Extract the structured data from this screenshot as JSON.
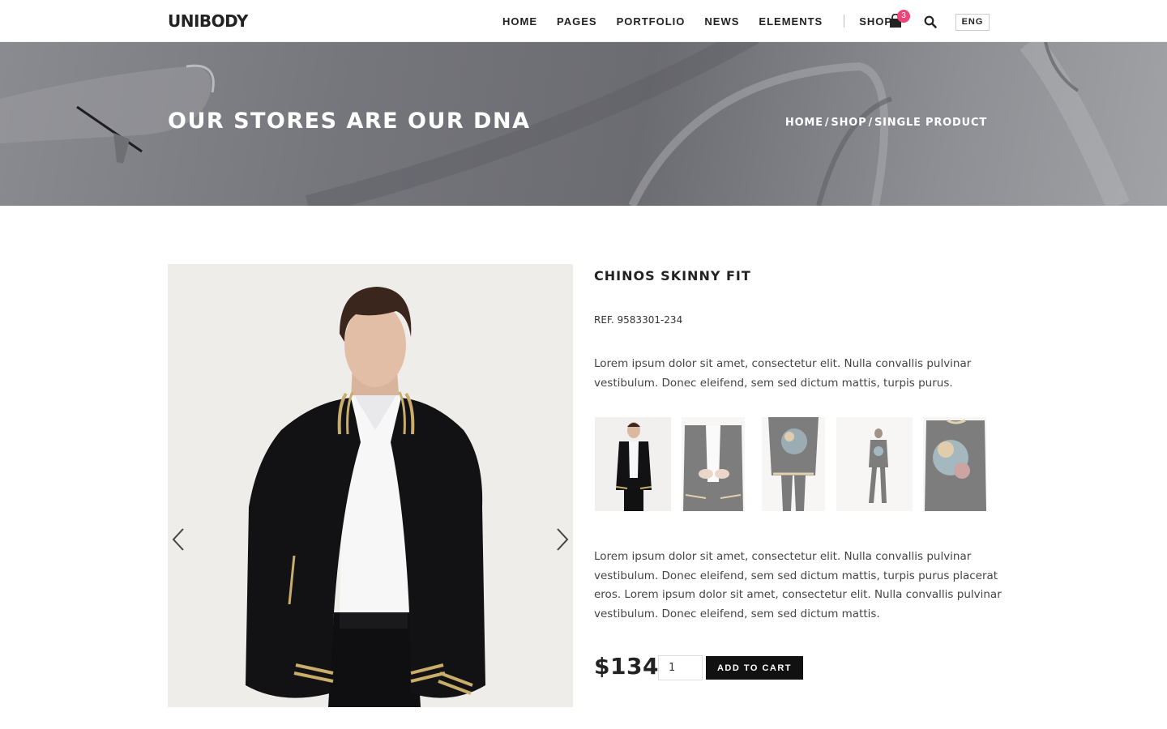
{
  "header": {
    "logo": "UNIBODY",
    "nav": [
      "HOME",
      "PAGES",
      "PORTFOLIO",
      "NEWS",
      "ELEMENTS"
    ],
    "shop": "SHOP",
    "cart_count": "3",
    "lang": "ENG"
  },
  "banner": {
    "title": "OUR STORES ARE OUR DNA",
    "breadcrumb": [
      "HOME",
      "SHOP",
      "SINGLE PRODUCT"
    ]
  },
  "product": {
    "title": "CHINOS SKINNY FIT",
    "ref": "REF. 9583301-234",
    "description_short": "Lorem ipsum dolor sit amet, consectetur elit. Nulla convallis pulvinar vestibulum. Donec eleifend, sem sed dictum mattis, turpis purus.",
    "description_long": "Lorem ipsum dolor sit amet, consectetur elit. Nulla convallis pulvinar vestibulum. Donec eleifend, sem sed dictum mattis, turpis purus placerat eros. Lorem ipsum dolor sit amet, consectetur elit. Nulla convallis pulvinar vestibulum. Donec eleifend, sem sed dictum mattis.",
    "price": "$134",
    "quantity": "1",
    "add_to_cart": "ADD TO CART"
  },
  "colors": {
    "badge": "#f0437a",
    "button": "#111111",
    "jacket": "#121214",
    "stripe": "#c9ad6a"
  }
}
